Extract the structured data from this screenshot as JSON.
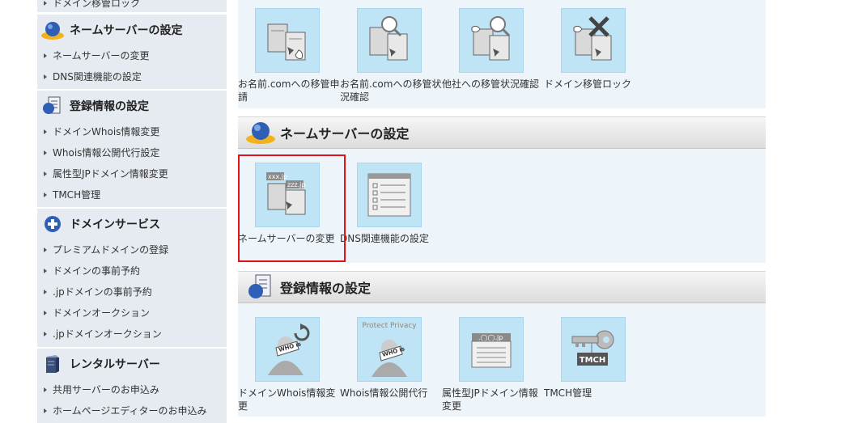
{
  "sidebar": {
    "cut_item": "ドメイン移管ロック",
    "sections": [
      {
        "title": "ネームサーバーの設定",
        "icon": "globe-person-icon",
        "items": [
          "ネームサーバーの変更",
          "DNS関連機能の設定"
        ]
      },
      {
        "title": "登録情報の設定",
        "icon": "document-globe-icon",
        "items": [
          "ドメインWhois情報変更",
          "Whois情報公開代行設定",
          "属性型JPドメイン情報変更",
          "TMCH管理"
        ]
      },
      {
        "title": "ドメインサービス",
        "icon": "plus-circle-icon",
        "items": [
          "プレミアムドメインの登録",
          "ドメインの事前予約",
          ".jpドメインの事前予約",
          "ドメインオークション",
          ".jpドメインオークション"
        ]
      },
      {
        "title": "レンタルサーバー",
        "icon": "server-icon",
        "items": [
          "共用サーバーのお申込み",
          "ホームページエディターのお申込み"
        ]
      }
    ]
  },
  "main": {
    "transfer_tiles": [
      {
        "label": "お名前.comへの移管申請",
        "icon": "server-transfer-icon"
      },
      {
        "label": "お名前.comへの移管状況確認",
        "icon": "transfer-search-icon"
      },
      {
        "label": "他社への移管状況確認",
        "icon": "transfer-search-hand-icon"
      },
      {
        "label": "ドメイン移管ロック",
        "icon": "transfer-lock-icon"
      }
    ],
    "nameserver": {
      "title": "ネームサーバーの設定",
      "tiles": [
        {
          "label": "ネームサーバーの変更",
          "icon": "nameserver-change-icon",
          "domain1": "xxx.jp",
          "domain2": "zzz.jp"
        },
        {
          "label": "DNS関連機能の設定",
          "icon": "dns-list-icon"
        }
      ]
    },
    "registration": {
      "title": "登録情報の設定",
      "tiles": [
        {
          "label": "ドメインWhois情報変更",
          "icon": "whois-refresh-icon",
          "badge": "WHO is"
        },
        {
          "label": "Whois情報公開代行",
          "icon": "protect-privacy-icon",
          "badge": "WHO is",
          "caption": "Protect Privacy"
        },
        {
          "label": "属性型JPドメイン情報変更",
          "icon": "jp-domain-icon",
          "caption": ".◯◯.jp"
        },
        {
          "label": "TMCH管理",
          "icon": "tmch-key-icon",
          "caption": "TMCH"
        }
      ]
    }
  }
}
